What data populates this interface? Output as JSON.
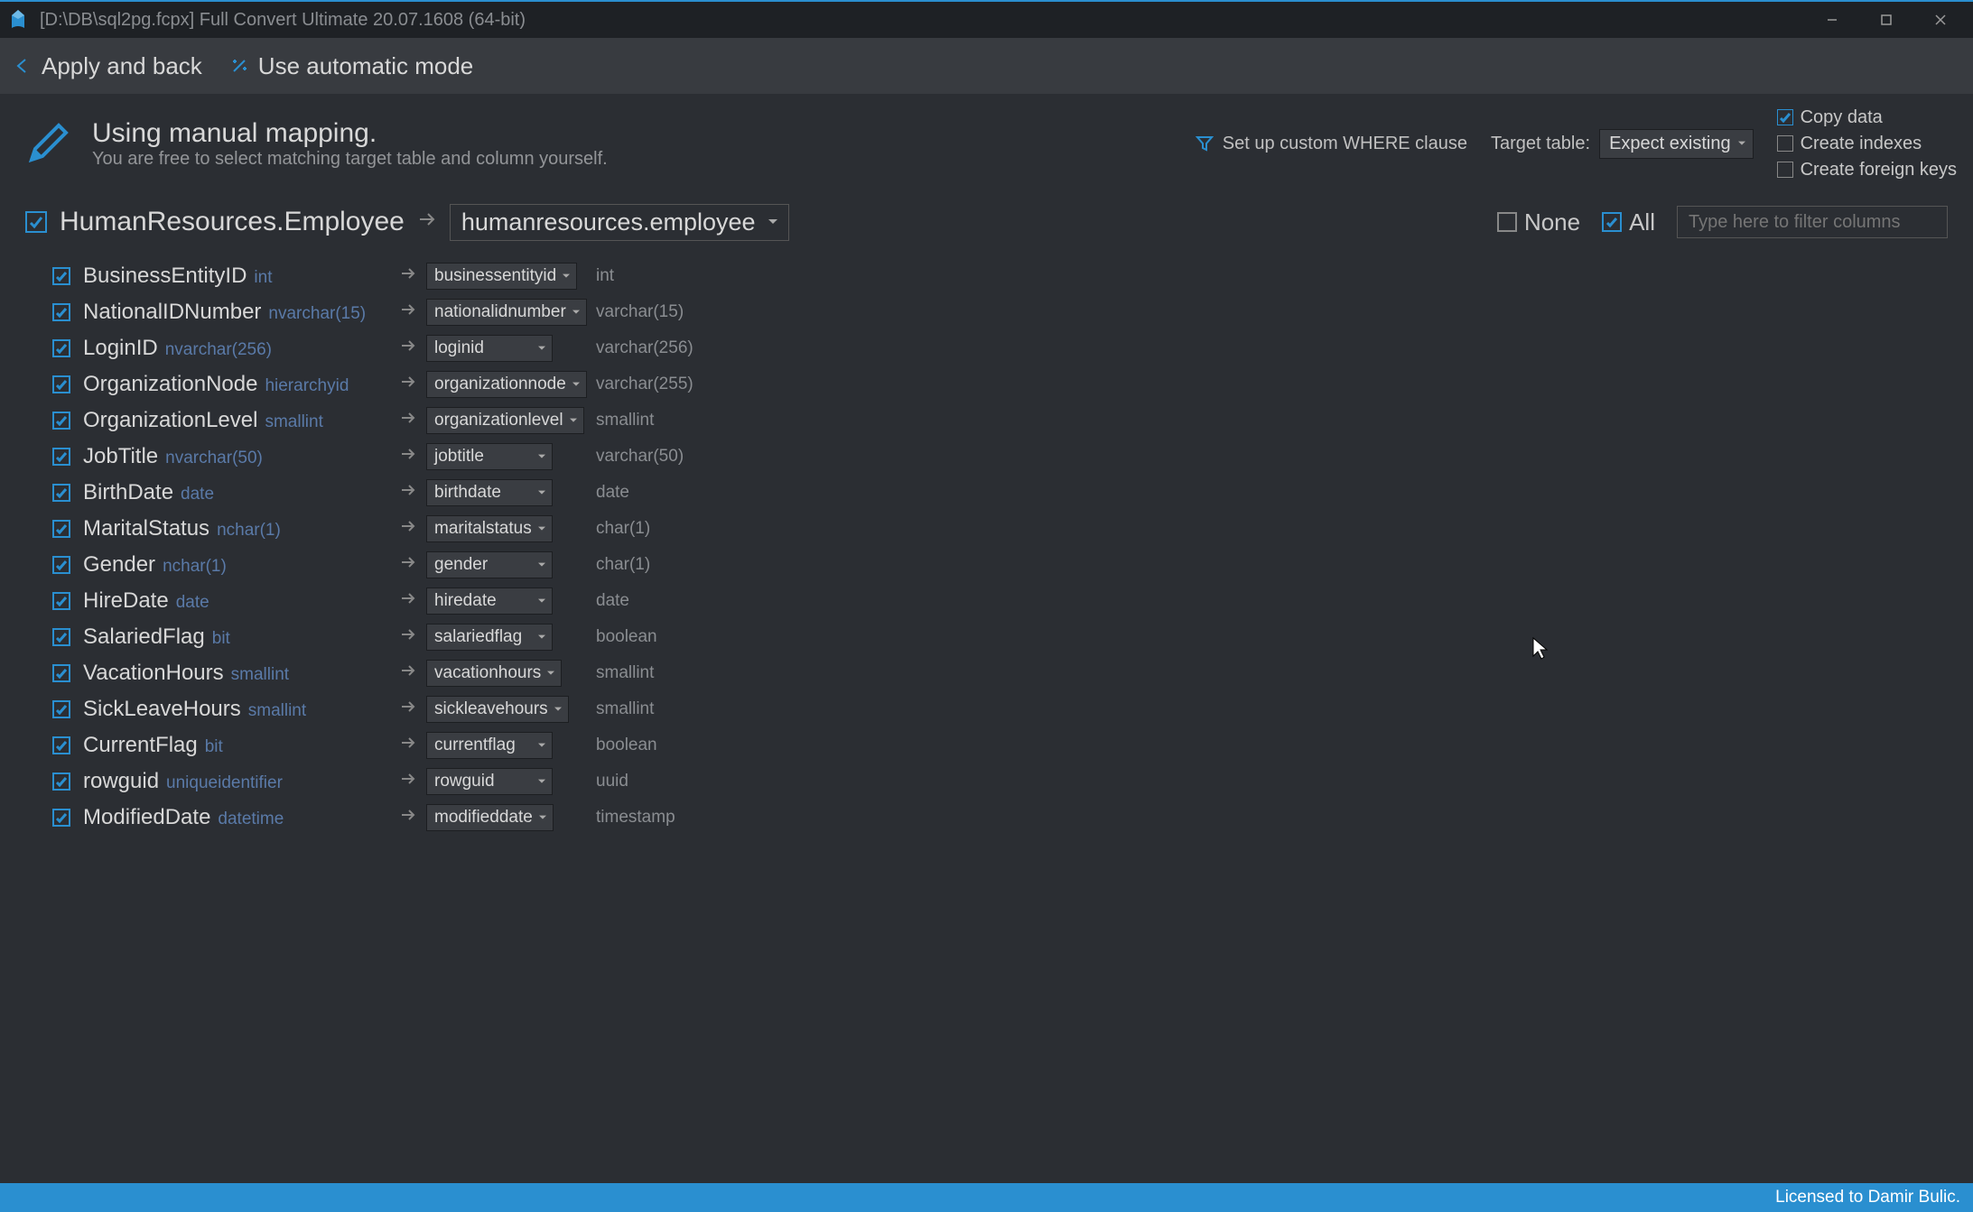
{
  "window": {
    "title": "[D:\\DB\\sql2pg.fcpx] Full Convert Ultimate 20.07.1608 (64-bit)"
  },
  "toolbar": {
    "apply_back": "Apply and back",
    "auto_mode": "Use automatic mode"
  },
  "info": {
    "headline": "Using manual mapping.",
    "subline": "You are free to select matching target table and column yourself.",
    "where": "Set up custom WHERE clause",
    "target_table_label": "Target table:",
    "target_table_value": "Expect existing",
    "copy_data": "Copy data",
    "create_indexes": "Create indexes",
    "create_fk": "Create foreign keys"
  },
  "table": {
    "source": "HumanResources.Employee",
    "target": "humanresources.employee",
    "none": "None",
    "all": "All",
    "filter_placeholder": "Type here to filter columns"
  },
  "columns": [
    {
      "src": "BusinessEntityID",
      "src_type": "int",
      "tgt": "businessentityid",
      "tgt_type": "int"
    },
    {
      "src": "NationalIDNumber",
      "src_type": "nvarchar(15)",
      "tgt": "nationalidnumber",
      "tgt_type": "varchar(15)"
    },
    {
      "src": "LoginID",
      "src_type": "nvarchar(256)",
      "tgt": "loginid",
      "tgt_type": "varchar(256)"
    },
    {
      "src": "OrganizationNode",
      "src_type": "hierarchyid",
      "tgt": "organizationnode",
      "tgt_type": "varchar(255)"
    },
    {
      "src": "OrganizationLevel",
      "src_type": "smallint",
      "tgt": "organizationlevel",
      "tgt_type": "smallint"
    },
    {
      "src": "JobTitle",
      "src_type": "nvarchar(50)",
      "tgt": "jobtitle",
      "tgt_type": "varchar(50)"
    },
    {
      "src": "BirthDate",
      "src_type": "date",
      "tgt": "birthdate",
      "tgt_type": "date"
    },
    {
      "src": "MaritalStatus",
      "src_type": "nchar(1)",
      "tgt": "maritalstatus",
      "tgt_type": "char(1)"
    },
    {
      "src": "Gender",
      "src_type": "nchar(1)",
      "tgt": "gender",
      "tgt_type": "char(1)"
    },
    {
      "src": "HireDate",
      "src_type": "date",
      "tgt": "hiredate",
      "tgt_type": "date"
    },
    {
      "src": "SalariedFlag",
      "src_type": "bit",
      "tgt": "salariedflag",
      "tgt_type": "boolean"
    },
    {
      "src": "VacationHours",
      "src_type": "smallint",
      "tgt": "vacationhours",
      "tgt_type": "smallint"
    },
    {
      "src": "SickLeaveHours",
      "src_type": "smallint",
      "tgt": "sickleavehours",
      "tgt_type": "smallint"
    },
    {
      "src": "CurrentFlag",
      "src_type": "bit",
      "tgt": "currentflag",
      "tgt_type": "boolean"
    },
    {
      "src": "rowguid",
      "src_type": "uniqueidentifier",
      "tgt": "rowguid",
      "tgt_type": "uuid"
    },
    {
      "src": "ModifiedDate",
      "src_type": "datetime",
      "tgt": "modifieddate",
      "tgt_type": "timestamp"
    }
  ],
  "status": "Licensed to Damir Bulic."
}
